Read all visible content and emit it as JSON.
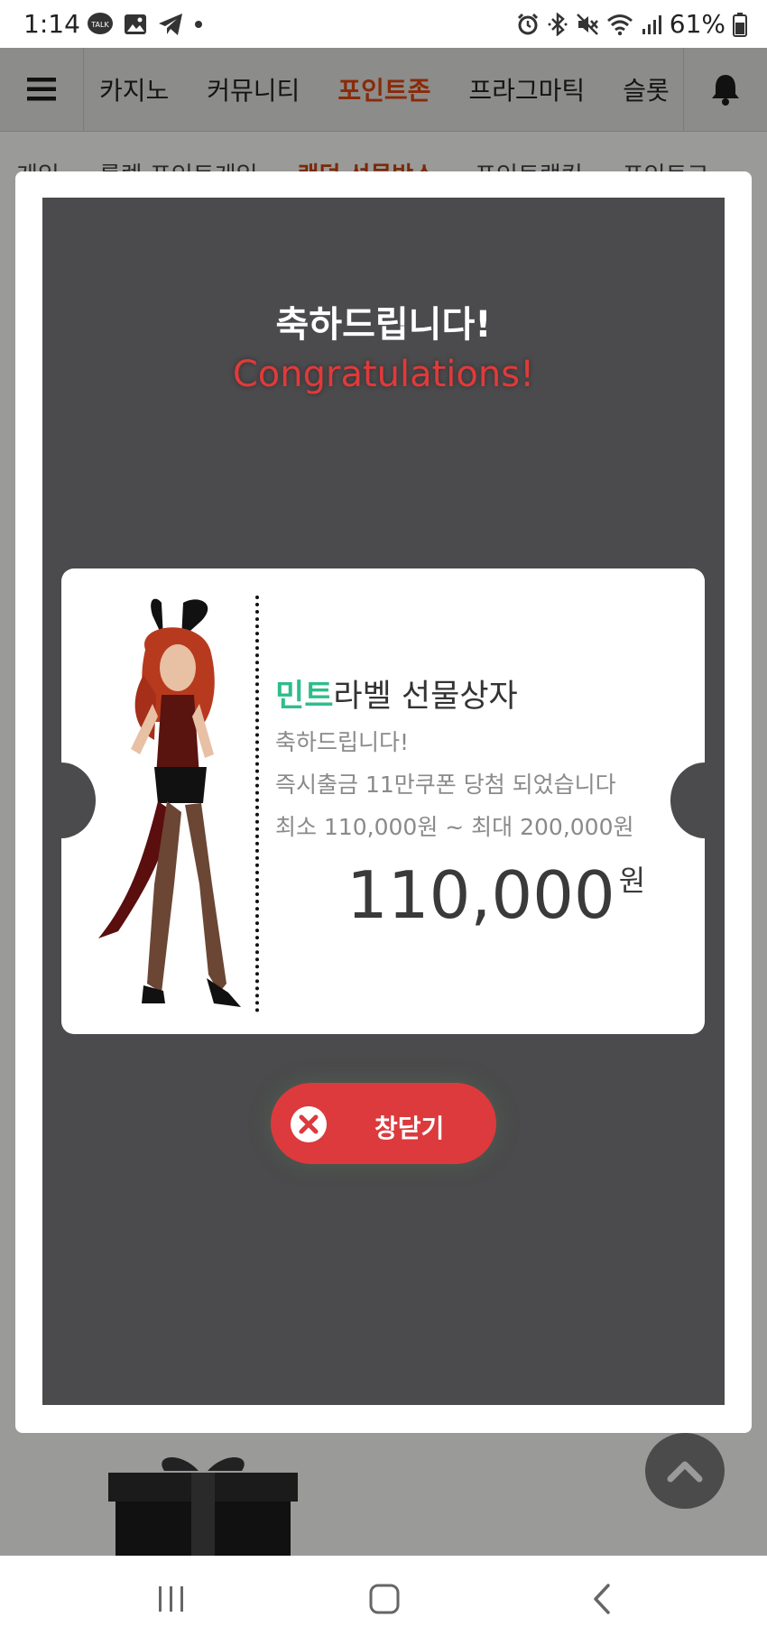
{
  "status_bar": {
    "time": "1:14",
    "battery": "61%",
    "left_icons": [
      "kakaotalk-icon",
      "image-icon",
      "telegram-icon",
      "dot-icon"
    ],
    "right_icons": [
      "alarm-icon",
      "bluetooth-icon",
      "mute-icon",
      "wifi-icon",
      "signal-icon",
      "battery-icon"
    ]
  },
  "top_nav": {
    "tabs": [
      "카지노",
      "커뮤니티",
      "포인트존",
      "프라그마틱",
      "슬롯"
    ],
    "active_tab": "포인트존"
  },
  "sub_nav": {
    "items": [
      "게임",
      "룰렛 포인트게임",
      "랜덤 선물박스",
      "포인트랭킹",
      "포인트교"
    ],
    "active_item": "랜덤 선물박스"
  },
  "modal": {
    "title_ko": "축하드립니다!",
    "title_en": "Congratulations!",
    "ticket": {
      "name_accent": "민트",
      "name_rest": "라벨 선물상자",
      "line1": "축하드립니다!",
      "line2": "즉시출금 11만쿠폰 당첨 되었습니다",
      "line3": "최소 110,000원 ~ 최대 200,000원",
      "amount": "110,000",
      "currency": "원"
    },
    "close_label": "창닫기"
  },
  "colors": {
    "accent_green": "#2fbd8a",
    "congrats_red": "#e03a3a",
    "close_button": "#dc3a3d",
    "active_nav": "#8a2a08",
    "panel": "#4b4a4c"
  }
}
